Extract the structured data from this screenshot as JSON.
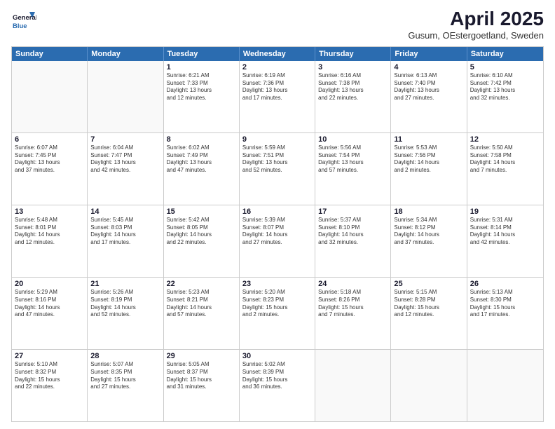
{
  "logo": {
    "general": "General",
    "blue": "Blue"
  },
  "header": {
    "title": "April 2025",
    "subtitle": "Gusum, OEstergoetland, Sweden"
  },
  "weekdays": [
    "Sunday",
    "Monday",
    "Tuesday",
    "Wednesday",
    "Thursday",
    "Friday",
    "Saturday"
  ],
  "weeks": [
    [
      {
        "day": "",
        "text": ""
      },
      {
        "day": "",
        "text": ""
      },
      {
        "day": "1",
        "text": "Sunrise: 6:21 AM\nSunset: 7:33 PM\nDaylight: 13 hours\nand 12 minutes."
      },
      {
        "day": "2",
        "text": "Sunrise: 6:19 AM\nSunset: 7:36 PM\nDaylight: 13 hours\nand 17 minutes."
      },
      {
        "day": "3",
        "text": "Sunrise: 6:16 AM\nSunset: 7:38 PM\nDaylight: 13 hours\nand 22 minutes."
      },
      {
        "day": "4",
        "text": "Sunrise: 6:13 AM\nSunset: 7:40 PM\nDaylight: 13 hours\nand 27 minutes."
      },
      {
        "day": "5",
        "text": "Sunrise: 6:10 AM\nSunset: 7:42 PM\nDaylight: 13 hours\nand 32 minutes."
      }
    ],
    [
      {
        "day": "6",
        "text": "Sunrise: 6:07 AM\nSunset: 7:45 PM\nDaylight: 13 hours\nand 37 minutes."
      },
      {
        "day": "7",
        "text": "Sunrise: 6:04 AM\nSunset: 7:47 PM\nDaylight: 13 hours\nand 42 minutes."
      },
      {
        "day": "8",
        "text": "Sunrise: 6:02 AM\nSunset: 7:49 PM\nDaylight: 13 hours\nand 47 minutes."
      },
      {
        "day": "9",
        "text": "Sunrise: 5:59 AM\nSunset: 7:51 PM\nDaylight: 13 hours\nand 52 minutes."
      },
      {
        "day": "10",
        "text": "Sunrise: 5:56 AM\nSunset: 7:54 PM\nDaylight: 13 hours\nand 57 minutes."
      },
      {
        "day": "11",
        "text": "Sunrise: 5:53 AM\nSunset: 7:56 PM\nDaylight: 14 hours\nand 2 minutes."
      },
      {
        "day": "12",
        "text": "Sunrise: 5:50 AM\nSunset: 7:58 PM\nDaylight: 14 hours\nand 7 minutes."
      }
    ],
    [
      {
        "day": "13",
        "text": "Sunrise: 5:48 AM\nSunset: 8:01 PM\nDaylight: 14 hours\nand 12 minutes."
      },
      {
        "day": "14",
        "text": "Sunrise: 5:45 AM\nSunset: 8:03 PM\nDaylight: 14 hours\nand 17 minutes."
      },
      {
        "day": "15",
        "text": "Sunrise: 5:42 AM\nSunset: 8:05 PM\nDaylight: 14 hours\nand 22 minutes."
      },
      {
        "day": "16",
        "text": "Sunrise: 5:39 AM\nSunset: 8:07 PM\nDaylight: 14 hours\nand 27 minutes."
      },
      {
        "day": "17",
        "text": "Sunrise: 5:37 AM\nSunset: 8:10 PM\nDaylight: 14 hours\nand 32 minutes."
      },
      {
        "day": "18",
        "text": "Sunrise: 5:34 AM\nSunset: 8:12 PM\nDaylight: 14 hours\nand 37 minutes."
      },
      {
        "day": "19",
        "text": "Sunrise: 5:31 AM\nSunset: 8:14 PM\nDaylight: 14 hours\nand 42 minutes."
      }
    ],
    [
      {
        "day": "20",
        "text": "Sunrise: 5:29 AM\nSunset: 8:16 PM\nDaylight: 14 hours\nand 47 minutes."
      },
      {
        "day": "21",
        "text": "Sunrise: 5:26 AM\nSunset: 8:19 PM\nDaylight: 14 hours\nand 52 minutes."
      },
      {
        "day": "22",
        "text": "Sunrise: 5:23 AM\nSunset: 8:21 PM\nDaylight: 14 hours\nand 57 minutes."
      },
      {
        "day": "23",
        "text": "Sunrise: 5:20 AM\nSunset: 8:23 PM\nDaylight: 15 hours\nand 2 minutes."
      },
      {
        "day": "24",
        "text": "Sunrise: 5:18 AM\nSunset: 8:26 PM\nDaylight: 15 hours\nand 7 minutes."
      },
      {
        "day": "25",
        "text": "Sunrise: 5:15 AM\nSunset: 8:28 PM\nDaylight: 15 hours\nand 12 minutes."
      },
      {
        "day": "26",
        "text": "Sunrise: 5:13 AM\nSunset: 8:30 PM\nDaylight: 15 hours\nand 17 minutes."
      }
    ],
    [
      {
        "day": "27",
        "text": "Sunrise: 5:10 AM\nSunset: 8:32 PM\nDaylight: 15 hours\nand 22 minutes."
      },
      {
        "day": "28",
        "text": "Sunrise: 5:07 AM\nSunset: 8:35 PM\nDaylight: 15 hours\nand 27 minutes."
      },
      {
        "day": "29",
        "text": "Sunrise: 5:05 AM\nSunset: 8:37 PM\nDaylight: 15 hours\nand 31 minutes."
      },
      {
        "day": "30",
        "text": "Sunrise: 5:02 AM\nSunset: 8:39 PM\nDaylight: 15 hours\nand 36 minutes."
      },
      {
        "day": "",
        "text": ""
      },
      {
        "day": "",
        "text": ""
      },
      {
        "day": "",
        "text": ""
      }
    ]
  ]
}
